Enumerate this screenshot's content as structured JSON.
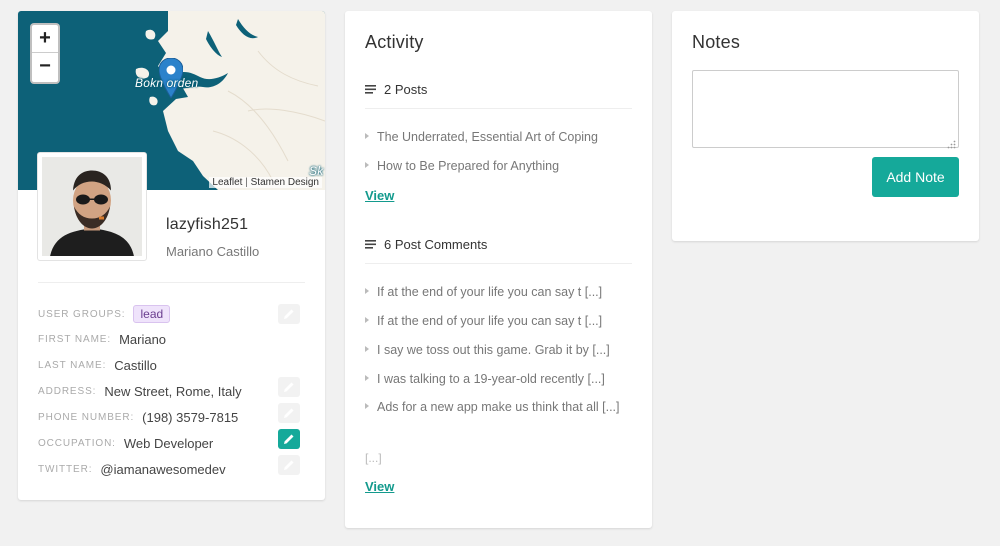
{
  "profile": {
    "map": {
      "zoom_in": "+",
      "zoom_out": "−",
      "place_label": "Bokn orden",
      "corner_label": "Sk",
      "attribution": {
        "leaflet": "Leaflet",
        "separator": "|",
        "stamen": "Stamen Design"
      }
    },
    "username": "lazyfish251",
    "full_name": "Mariano Castillo",
    "fields": {
      "user_groups": {
        "label": "User Groups:",
        "value": "lead"
      },
      "first_name": {
        "label": "First Name:",
        "value": "Mariano"
      },
      "last_name": {
        "label": "Last Name:",
        "value": "Castillo"
      },
      "address": {
        "label": "Address:",
        "value": "New Street, Rome, Italy"
      },
      "phone": {
        "label": "Phone Number:",
        "value": "(198) 3579-7815"
      },
      "occupation": {
        "label": "Occupation:",
        "value": "Web Developer"
      },
      "twitter": {
        "label": "Twitter:",
        "value": "@iamanawesomedev"
      }
    }
  },
  "activity": {
    "title": "Activity",
    "posts": {
      "heading": "2 Posts",
      "items": [
        "The Underrated, Essential Art of Coping",
        "How to Be Prepared for Anything"
      ],
      "view": "View"
    },
    "comments": {
      "heading": "6 Post Comments",
      "items": [
        "If at the end of your life you can say t [...]",
        "If at the end of your life you can say t [...]",
        "I say we toss out this game. Grab it by [...]",
        "I was talking to a 19-year-old recently [...]",
        "Ads for a new app make us think that all [...]"
      ],
      "more": "[...]",
      "view": "View"
    }
  },
  "notes": {
    "title": "Notes",
    "textarea_value": "",
    "add_button": "Add Note"
  },
  "colors": {
    "accent": "#15a99a",
    "map_water": "#0d6178",
    "map_land": "#f5f2ea",
    "tag_bg": "#efe3fb"
  }
}
